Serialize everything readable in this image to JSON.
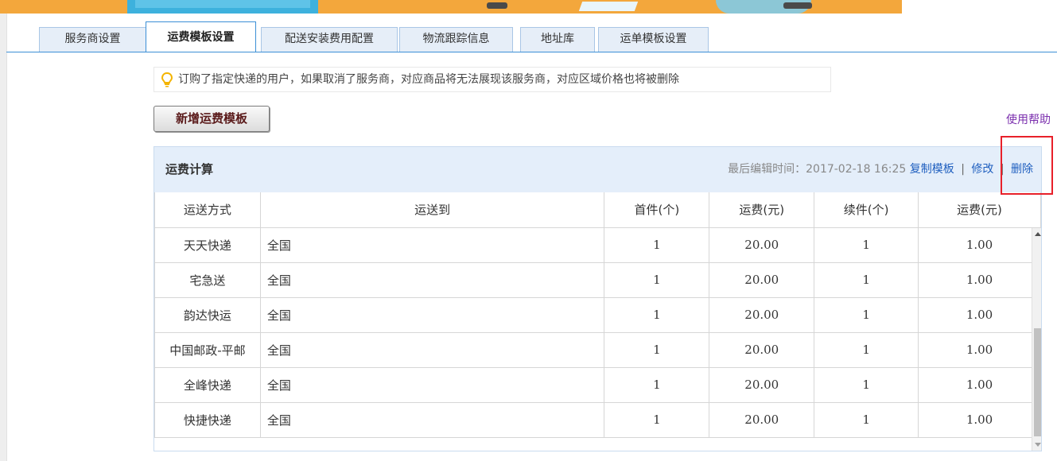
{
  "tabs": [
    {
      "label": "服务商设置",
      "active": false
    },
    {
      "label": "运费模板设置",
      "active": true
    },
    {
      "label": "配送安装费用配置",
      "active": false
    },
    {
      "label": "物流跟踪信息",
      "active": false
    },
    {
      "label": "地址库",
      "active": false
    },
    {
      "label": "运单模板设置",
      "active": false
    }
  ],
  "notice": {
    "text": "订购了指定快递的用户，如果取消了服务商，对应商品将无法展现该服务商，对应区域价格也将被删除",
    "icon": "lightbulb-icon"
  },
  "toolbar": {
    "add_label": "新增运费模板",
    "help_label": "使用帮助"
  },
  "panel": {
    "title": "运费计算",
    "meta_label": "最后编辑时间：",
    "edit_time": "2017-02-18 16:25",
    "copy_label": "复制模板",
    "sep": "|",
    "edit_label": "修改",
    "delete_label": "删除"
  },
  "table": {
    "headers": [
      "运送方式",
      "运送到",
      "首件(个)",
      "运费(元)",
      "续件(个)",
      "运费(元)"
    ],
    "rows": [
      [
        "天天快递",
        "全国",
        "1",
        "20.00",
        "1",
        "1.00"
      ],
      [
        "宅急送",
        "全国",
        "1",
        "20.00",
        "1",
        "1.00"
      ],
      [
        "韵达快运",
        "全国",
        "1",
        "20.00",
        "1",
        "1.00"
      ],
      [
        "中国邮政-平邮",
        "全国",
        "1",
        "20.00",
        "1",
        "1.00"
      ],
      [
        "全峰快递",
        "全国",
        "1",
        "20.00",
        "1",
        "1.00"
      ],
      [
        "快捷快递",
        "全国",
        "1",
        "20.00",
        "1",
        "1.00"
      ]
    ]
  },
  "colors": {
    "tab_border": "#3b8fd6",
    "header_bg": "#e4eefa",
    "link": "#1f5fbf",
    "help_link": "#7b2fae",
    "highlight": "#e8202a"
  }
}
